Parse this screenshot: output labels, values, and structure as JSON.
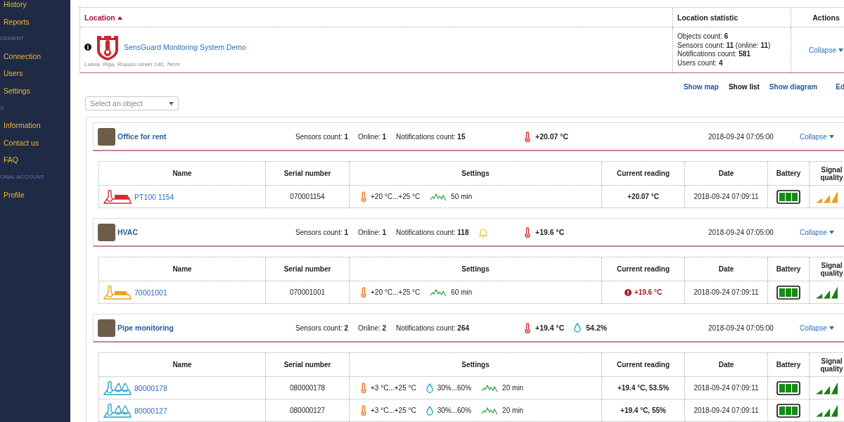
{
  "sidebar": {
    "items": [
      {
        "kind": "link",
        "label": "History"
      },
      {
        "kind": "link",
        "label": "Reports"
      },
      {
        "kind": "section",
        "label": "GEMENT"
      },
      {
        "kind": "link",
        "label": "Connection"
      },
      {
        "kind": "link",
        "label": "Users"
      },
      {
        "kind": "link",
        "label": "Settings"
      },
      {
        "kind": "section",
        "label": "S"
      },
      {
        "kind": "link",
        "label": "Information"
      },
      {
        "kind": "link",
        "label": "Contact us"
      },
      {
        "kind": "link",
        "label": "FAQ"
      },
      {
        "kind": "section",
        "label": "ONAL ACCOUNT"
      },
      {
        "kind": "link",
        "label": "Profile"
      }
    ]
  },
  "location_table": {
    "columns": [
      {
        "label": "Location",
        "sorted": true
      },
      {
        "label": "Location statistic",
        "sorted": false
      },
      {
        "label": "Actions",
        "sorted": false
      }
    ],
    "location": {
      "name": "SensGuard Monitoring System Demo",
      "address": "Latvia, Riga, Ropazu street 140, Tecm"
    },
    "statistics": [
      "Objects count: **6**",
      "Sensors count: **11** (online: **11**)",
      "Notifications count: **581**",
      "Users count: **4**"
    ],
    "action": "Collapse"
  },
  "view_links": [
    {
      "label": "Show map",
      "selected": false
    },
    {
      "label": "Show list",
      "selected": true
    },
    {
      "label": "Show diagram",
      "selected": false
    },
    {
      "label": "Ed",
      "selected": false
    }
  ],
  "object_select": {
    "placeholder": "Select an object"
  },
  "objects": [
    {
      "name": "Office for rent",
      "stats": [
        "Sensors count: **1**",
        "Online: **1**",
        "Notifications count: **15**"
      ],
      "notification_bell": false,
      "readings": [
        {
          "kind": "temperature",
          "text": "+20.07 °C"
        }
      ],
      "date": "2018-09-24 07:05:00",
      "action": "Collapse",
      "columns": [
        "Name",
        "Serial number",
        "Settings",
        "Current reading",
        "Date",
        "Battery",
        "Signal quality"
      ],
      "sensors": [
        {
          "kind": "pt100",
          "name": "PT100 1154",
          "serial": "070001154",
          "settings": [
            {
              "kind": "temperature",
              "text": "+20 °C...+25 °C"
            },
            {
              "kind": "interval",
              "text": "50 min"
            }
          ],
          "reading": "+20.07 °C",
          "alert": false,
          "date": "2018-09-24 07:09:11",
          "signal": {
            "color": "#e8a317"
          }
        }
      ]
    },
    {
      "name": "HVAC",
      "stats": [
        "Sensors count: **1**",
        "Online: **1**",
        "Notifications count: **118**"
      ],
      "notification_bell": true,
      "readings": [
        {
          "kind": "temperature",
          "text": "+19.6 °C"
        }
      ],
      "date": "2018-09-24 07:05:00",
      "action": "Collapse",
      "columns": [
        "Name",
        "Serial number",
        "Settings",
        "Current reading",
        "Date",
        "Battery",
        "Signal quality"
      ],
      "sensors": [
        {
          "kind": "temperature",
          "name": "70001001",
          "serial": "070001001",
          "settings": [
            {
              "kind": "temperature",
              "text": "+20 °C...+25 °C"
            },
            {
              "kind": "interval",
              "text": "60 min"
            }
          ],
          "reading": "+19.6 °C",
          "alert": true,
          "date": "2018-09-24 07:09:11",
          "signal": {
            "color": "#1a7f1a"
          }
        }
      ]
    },
    {
      "name": "Pipe monitoring",
      "stats": [
        "Sensors count: **2**",
        "Online: **2**",
        "Notifications count: **264**"
      ],
      "notification_bell": false,
      "readings": [
        {
          "kind": "temperature",
          "text": "+19.4 °C"
        },
        {
          "kind": "humidity",
          "text": "54.2%"
        }
      ],
      "date": "2018-09-24 07:05:00",
      "action": "Collapse",
      "columns": [
        "Name",
        "Serial number",
        "Settings",
        "Current reading",
        "Date",
        "Battery",
        "Signal quality"
      ],
      "sensors": [
        {
          "kind": "temperature-humidity",
          "name": "80000178",
          "serial": "080000178",
          "settings": [
            {
              "kind": "temperature",
              "text": "+3 °C...+25 °C"
            },
            {
              "kind": "humidity",
              "text": "30%...60%"
            },
            {
              "kind": "interval",
              "text": "20 min"
            }
          ],
          "reading": "+19.4 °C, 53.5%",
          "alert": false,
          "date": "2018-09-24 07:09:11",
          "signal": {
            "color": "#1a7f1a"
          }
        },
        {
          "kind": "temperature-humidity",
          "name": "80000127",
          "serial": "080000127",
          "settings": [
            {
              "kind": "temperature",
              "text": "+3 °C...+25 °C"
            },
            {
              "kind": "humidity",
              "text": "30%...60%"
            },
            {
              "kind": "interval",
              "text": "20 min"
            }
          ],
          "reading": "+19.4 °C, 55%",
          "alert": false,
          "date": "2018-09-24 07:09:11",
          "signal": {
            "color": "#1a7f1a"
          }
        }
      ]
    }
  ]
}
